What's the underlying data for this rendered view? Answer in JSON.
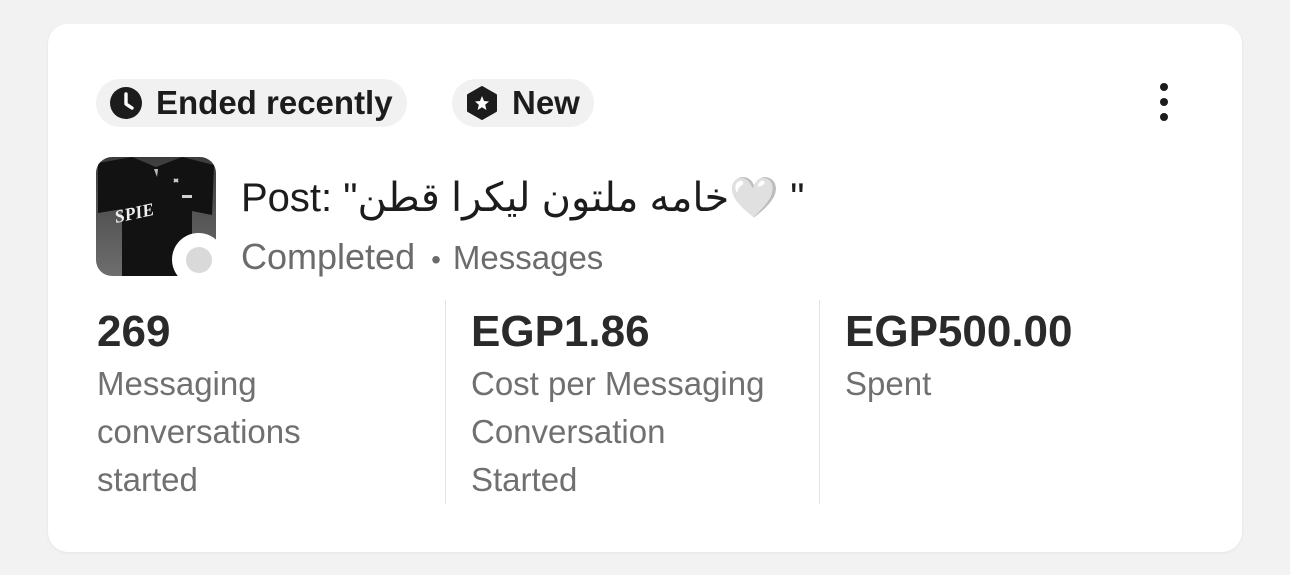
{
  "badges": {
    "ended": {
      "icon": "clock-icon",
      "label": "Ended recently"
    },
    "new": {
      "icon": "hexagon-star-icon",
      "label": "New"
    }
  },
  "menu": {
    "icon": "more-vertical-icon"
  },
  "ad": {
    "thumbnail": "post-thumbnail-image",
    "title": "Post: \"خامه ملتون ليكرا قطن🤍 \"",
    "status": "Completed",
    "separator": "•",
    "objective": "Messages"
  },
  "metrics": [
    {
      "value": "269",
      "label_lines": [
        "Messaging",
        "conversations",
        "started"
      ]
    },
    {
      "value": "EGP1.86",
      "label_lines": [
        "Cost per Messaging",
        "Conversation",
        "Started"
      ]
    },
    {
      "value": "EGP500.00",
      "label_lines": [
        "Spent"
      ]
    }
  ],
  "colors": {
    "background": "#f2f2f2",
    "card": "#ffffff",
    "pill": "#f1f1f1",
    "text_primary": "#1c1c1c",
    "text_secondary": "#6b6b6b",
    "status_dot": "#d9d9d9"
  }
}
